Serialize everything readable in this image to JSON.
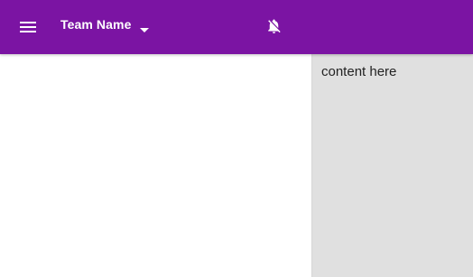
{
  "theme": {
    "accent": "#7b14a3",
    "icon_color": "#ffffff",
    "panel_bg": "#e0e0e0"
  },
  "toolbar": {
    "menu_icon": "menu-icon",
    "team_name": "Team Name",
    "team_caret_icon": "arrow-drop-down-icon",
    "notifications_icon": "notifications-off-icon"
  },
  "side_panel": {
    "content": "content here"
  }
}
